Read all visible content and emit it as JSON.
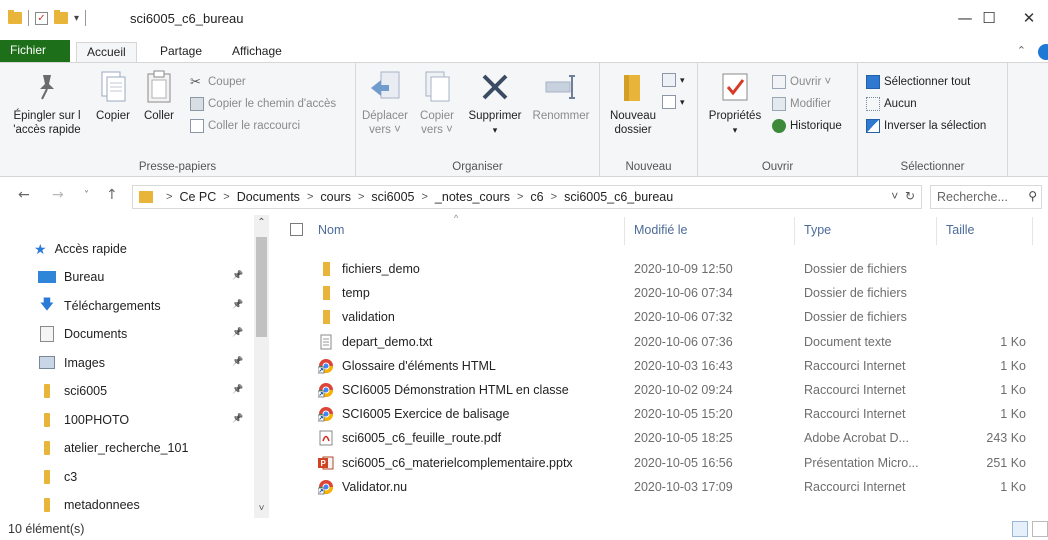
{
  "window": {
    "title": "sci6005_c6_bureau",
    "controls": {
      "minimize": "—",
      "maximize": "☐",
      "close": "✕"
    }
  },
  "tabs": {
    "fichier": "Fichier",
    "accueil": "Accueil",
    "partage": "Partage",
    "affichage": "Affichage"
  },
  "ribbon": {
    "presse_papiers": {
      "label": "Presse-papiers",
      "pin": "Épingler sur l’accès rapide",
      "pin_line1": "Épingler sur l",
      "pin_line2": "'accès rapide",
      "copier": "Copier",
      "coller": "Coller",
      "couper": "Couper",
      "copier_chemin": "Copier le chemin d'accès",
      "coller_raccourci": "Coller le raccourci"
    },
    "organiser": {
      "label": "Organiser",
      "deplacer_line1": "Déplacer",
      "deplacer_line2": "vers ˅",
      "copier_line1": "Copier",
      "copier_line2": "vers ˅",
      "supprimer": "Supprimer",
      "renommer": "Renommer"
    },
    "nouveau": {
      "label": "Nouveau",
      "dossier_line1": "Nouveau",
      "dossier_line2": "dossier"
    },
    "ouvrir": {
      "label": "Ouvrir",
      "proprietes": "Propriétés",
      "ouvrir": "Ouvrir ˅",
      "modifier": "Modifier",
      "historique": "Historique"
    },
    "selectionner": {
      "label": "Sélectionner",
      "tout": "Sélectionner tout",
      "aucun": "Aucun",
      "inverser": "Inverser la sélection"
    }
  },
  "address": {
    "crumbs": [
      "Ce PC",
      "Documents",
      "cours",
      "sci6005",
      "_notes_cours",
      "c6",
      "sci6005_c6_bureau"
    ],
    "search_placeholder": "Recherche..."
  },
  "nav": {
    "quick_access": "Accès rapide",
    "items": [
      {
        "label": "Bureau",
        "icon": "desktop-icon",
        "pinned": true
      },
      {
        "label": "Téléchargements",
        "icon": "download-icon",
        "pinned": true
      },
      {
        "label": "Documents",
        "icon": "documents-icon",
        "pinned": true
      },
      {
        "label": "Images",
        "icon": "images-icon",
        "pinned": true
      },
      {
        "label": "sci6005",
        "icon": "folder-icon",
        "pinned": true
      },
      {
        "label": "100PHOTO",
        "icon": "folder-icon",
        "pinned": true
      },
      {
        "label": "atelier_recherche_101",
        "icon": "folder-icon",
        "pinned": false
      },
      {
        "label": "c3",
        "icon": "folder-icon",
        "pinned": false
      },
      {
        "label": "metadonnees",
        "icon": "folder-icon",
        "pinned": false
      }
    ]
  },
  "columns": {
    "name": "Nom",
    "date": "Modifié le",
    "type": "Type",
    "size": "Taille"
  },
  "files": [
    {
      "name": "fichiers_demo",
      "date": "2020-10-09 12:50",
      "type": "Dossier de fichiers",
      "size": "",
      "icon": "folder-icon"
    },
    {
      "name": "temp",
      "date": "2020-10-06 07:34",
      "type": "Dossier de fichiers",
      "size": "",
      "icon": "folder-icon"
    },
    {
      "name": "validation",
      "date": "2020-10-06 07:32",
      "type": "Dossier de fichiers",
      "size": "",
      "icon": "folder-icon"
    },
    {
      "name": "depart_demo.txt",
      "date": "2020-10-06 07:36",
      "type": "Document texte",
      "size": "1 Ko",
      "icon": "text-file-icon"
    },
    {
      "name": "Glossaire d'éléments HTML",
      "date": "2020-10-03 16:43",
      "type": "Raccourci Internet",
      "size": "1 Ko",
      "icon": "chrome-shortcut-icon"
    },
    {
      "name": "SCI6005 Démonstration HTML en classe",
      "date": "2020-10-02 09:24",
      "type": "Raccourci Internet",
      "size": "1 Ko",
      "icon": "chrome-shortcut-icon"
    },
    {
      "name": "SCI6005 Exercice de balisage",
      "date": "2020-10-05 15:20",
      "type": "Raccourci Internet",
      "size": "1 Ko",
      "icon": "chrome-shortcut-icon"
    },
    {
      "name": "sci6005_c6_feuille_route.pdf",
      "date": "2020-10-05 18:25",
      "type": "Adobe Acrobat D...",
      "size": "243 Ko",
      "icon": "pdf-icon"
    },
    {
      "name": "sci6005_c6_materielcomplementaire.pptx",
      "date": "2020-10-05 16:56",
      "type": "Présentation Micro...",
      "size": "251 Ko",
      "icon": "pptx-icon"
    },
    {
      "name": "Validator.nu",
      "date": "2020-10-03 17:09",
      "type": "Raccourci Internet",
      "size": "1 Ko",
      "icon": "chrome-shortcut-icon"
    }
  ],
  "status": {
    "count": "10 élément(s)"
  },
  "colors": {
    "fichier_tab": "#1d6f1a",
    "folder": "#e8b43a",
    "header_text": "#4b6b98",
    "accent": "#1e78d6"
  }
}
